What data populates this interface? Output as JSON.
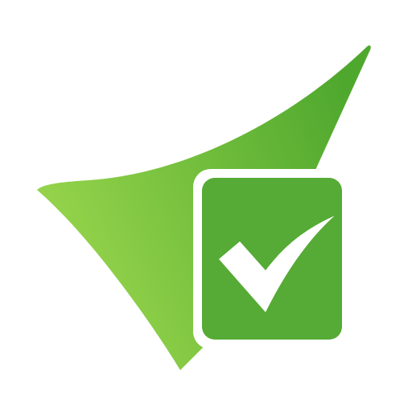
{
  "logo": {
    "colors": {
      "background": "#ffffff",
      "swoosh_light": "#93d24a",
      "swoosh_dark": "#4fa82e",
      "box_fill": "#55ab35",
      "box_border": "#ffffff",
      "check_mark": "#ffffff"
    },
    "icons": [
      "swoosh-shape",
      "checkbox-icon",
      "check-mark-icon"
    ]
  }
}
